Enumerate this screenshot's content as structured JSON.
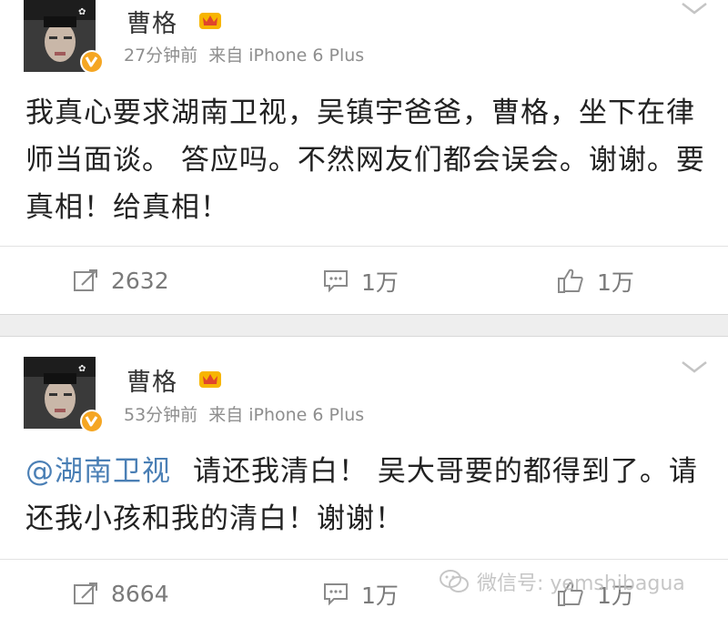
{
  "posts": [
    {
      "username": "曹格",
      "time": "27分钟前",
      "source": "来自 iPhone 6 Plus",
      "mention": "",
      "text": "我真心要求湖南卫视，吴镇宇爸爸，曹格，坐下在律师当面谈。 答应吗。不然网友们都会误会。谢谢。要真相！给真相！",
      "reposts": "2632",
      "comments": "1万",
      "likes": "1万"
    },
    {
      "username": "曹格",
      "time": "53分钟前",
      "source": "来自 iPhone 6 Plus",
      "mention": "@湖南卫视",
      "text": "请还我清白！ 吴大哥要的都得到了。请还我小孩和我的清白！谢谢！",
      "reposts": "8664",
      "comments": "1万",
      "likes": "1万"
    }
  ],
  "watermark": "微信号: yemshibagua",
  "colors": {
    "mention": "#4a7fb5",
    "verified_badge": "#f5a623",
    "meta": "#8e8e8e",
    "separator": "#eeeeee"
  },
  "icons": [
    "verified-badge-icon",
    "crown-icon",
    "chevron-down-icon",
    "repost-icon",
    "comment-icon",
    "like-icon",
    "wechat-icon"
  ]
}
